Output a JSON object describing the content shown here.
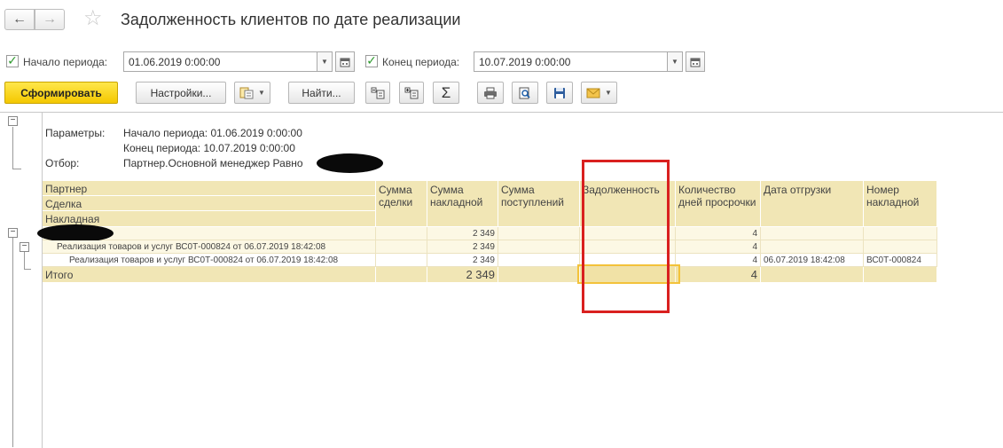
{
  "window": {
    "title": "Задолженность клиентов по дате реализации"
  },
  "period": {
    "start_label": "Начало периода:",
    "start_value": "01.06.2019  0:00:00",
    "end_label": "Конец периода:",
    "end_value": "10.07.2019  0:00:00"
  },
  "toolbar": {
    "generate": "Сформировать",
    "settings": "Настройки...",
    "find": "Найти...",
    "sum": "Σ"
  },
  "params": {
    "label": "Параметры:",
    "start": "Начало периода: 01.06.2019 0:00:00",
    "end": "Конец периода: 10.07.2019 0:00:00",
    "filter_label": "Отбор:",
    "filter_value": "Партнер.Основной менеджер Равно"
  },
  "table": {
    "headers": {
      "partner": "Партнер",
      "deal": "Сделка",
      "invoice": "Накладная",
      "deal_sum": "Сумма сделки",
      "invoice_sum": "Сумма накладной",
      "receipts_sum": "Сумма поступлений",
      "debt": "Задолженность",
      "overdue_days": "Количество дней просрочки",
      "ship_date": "Дата отгрузки",
      "invoice_no": "Номер накладной"
    },
    "group_row": {
      "invoice_sum": "2 349",
      "overdue_days": "4"
    },
    "deal_row": {
      "name": "Реализация товаров и услуг ВС0Т-000824 от 06.07.2019 18:42:08",
      "invoice_sum": "2 349",
      "overdue_days": "4"
    },
    "detail_row": {
      "name": "Реализация товаров и услуг ВС0Т-000824 от 06.07.2019 18:42:08",
      "invoice_sum": "2 349",
      "overdue_days": "4",
      "ship_date": "06.07.2019 18:42:08",
      "invoice_no": "ВС0Т-000824"
    },
    "total_row": {
      "label": "Итого",
      "invoice_sum": "2 349",
      "overdue_days": "4"
    }
  },
  "colors": {
    "header_bg": "#f1e6b5",
    "group_bg": "#fcf8e4",
    "primary_button": "#f4c800",
    "highlight_box": "#d9201f",
    "checkbox": "#2e9a2e"
  }
}
